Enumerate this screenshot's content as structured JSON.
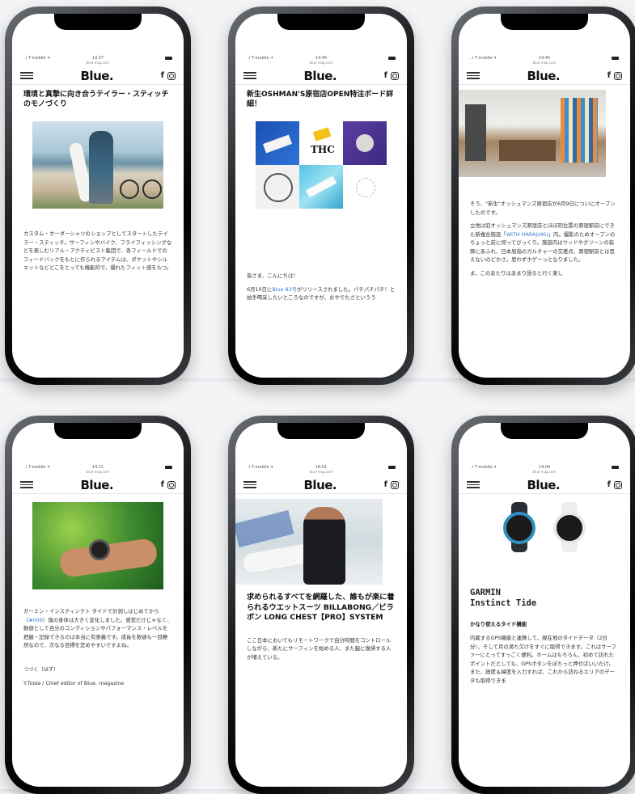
{
  "site": {
    "logo": "Blue."
  },
  "phones": [
    {
      "status": {
        "carrier": "..l T-mobile ✦",
        "time": "13:37",
        "url": "blue-mag.com"
      },
      "title": "環境と真摯に向き合うテイラー・スティッチのモノづくり",
      "body": "カスタム・オーダーシャツのショップとしてスタートしたテイラー・スティッチ。サーフィンやバイク、フライフィッシングなどを楽しむリアル・アクティビスト集団で、各フィールドでのフィードバックをもとに作られるアイテムは、ポケットやシルエットなどどこをとっても機能的で、優れたフィット感をもつ。"
    },
    {
      "status": {
        "carrier": "..l T-mobile ✦",
        "time": "14:45",
        "url": "blue-mag.com"
      },
      "title": "新生OSHMAN'S原宿店OPEN特注ボード詳細！",
      "mosaic_text": "THC",
      "body_intro": "皆さま、こんにちは！",
      "body_pre": "6月10日に",
      "body_link": "Blue 83号",
      "body_post": "がリリースされました。パチパチパチ！と拍手喝采したいところなのですが、おやでたさというう"
    },
    {
      "status": {
        "carrier": "..l T-mobile ✦",
        "time": "14:45",
        "url": "blue-mag.com"
      },
      "body_p1": "そう、\"新生\"オッシュマンズ原宿店が6月9日についにオープンしたのです。",
      "body_p2_pre": "立地は旧オッシュマンズ原宿店とほぼ同位置の原宿駅前にできた新複合施設「",
      "body_p2_link": "WITH HARAJUKU",
      "body_p2_post": "」内。撮影のためオープンのちょっと前に伺ってびっくり。施設内はウッドやグリーンの装飾にあふれ、日本屈指のカルチャーの交差点、原宿駅前とは思えないのどかさ。思わずホゲーっとなりました。",
      "body_p3": "ま、このあたりはあまり語ると行く楽し"
    },
    {
      "status": {
        "carrier": "..l T-mobile ✦",
        "time": "14:21",
        "url": "blue-mag.com"
      },
      "body_pre": "ガーミン・インスティンクト タイドで計測しはじめてから（",
      "body_link": "#006",
      "body_post": "）僕の身体は大きく変化しました。感覚だけじゃなく、数値として自分のコンディションやパフォーマンス・レベルを把握・記録できるのは本当に有意義です。成長を数値も一目瞭然なので、次なる目標を定めやすいですよね。",
      "tsuzuku": "つづく（はず）",
      "signature": "Y.Toida / Chief editor of Blue. magazine"
    },
    {
      "status": {
        "carrier": "..l T-mobile ✦",
        "time": "16:01",
        "url": "blue-mag.com"
      },
      "title": "求められるすべてを網羅した、誰もが楽に着られるウエットスーツ BILLABONG／ビラボン LONG CHEST【PRO】SYSTEM",
      "body": "ここ日本においてもリモートワークで自分時間をコントロールしながら、新たにサーフィンを始める人、また脇に復帰する人が増えている。"
    },
    {
      "status": {
        "carrier": "..l T-mobile ✦",
        "time": "14:04",
        "url": "blue-mag.com"
      },
      "title": "GARMIN\nInstinct Tide",
      "subhead": "かなり使えるタイド機能",
      "body": "内蔵するGPS機能と連携して、現在地のタイドデータ（2日分）、そして月の満ち欠けをすぐに取得できます。これはサーファーにとってすっごく便利。ホームはもちろん、初めて訪れたポイントだとしても、GPSボタンをぽちっと押せばいいだけ。",
      "body2": "また、経度＆緯度を入力すれば、これから訪ねるエリアのデータも取得できま"
    }
  ]
}
